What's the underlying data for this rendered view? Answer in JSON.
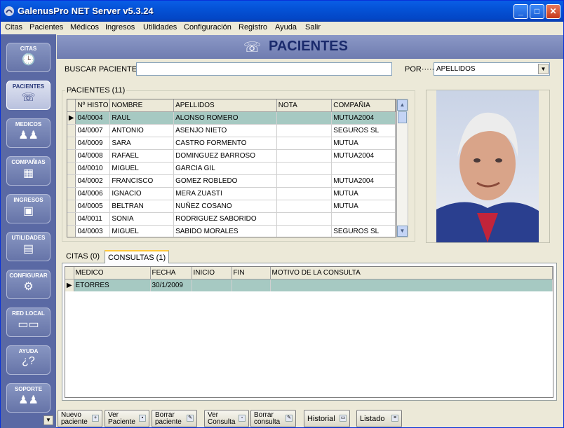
{
  "window": {
    "title": "GalenusPro NET Server v5.3.24"
  },
  "menu": [
    "Citas",
    "Pacientes",
    "Médicos",
    "Ingresos",
    "Utilidades",
    "Configuración",
    "Registro",
    "Ayuda",
    "Salir"
  ],
  "sidebar": [
    {
      "label": "CITAS",
      "icon": "clock-icon"
    },
    {
      "label": "PACIENTES",
      "icon": "patient-icon"
    },
    {
      "label": "MEDICOS",
      "icon": "doctors-icon"
    },
    {
      "label": "COMPAÑIAS",
      "icon": "building-icon"
    },
    {
      "label": "INGRESOS",
      "icon": "money-icon"
    },
    {
      "label": "UTILIDADES",
      "icon": "tools-icon"
    },
    {
      "label": "CONFIGURAR",
      "icon": "gears-icon"
    },
    {
      "label": "RED LOCAL",
      "icon": "network-icon"
    },
    {
      "label": "AYUDA",
      "icon": "help-icon"
    },
    {
      "label": "SOPORTE",
      "icon": "support-icon"
    }
  ],
  "header": {
    "title": "PACIENTES"
  },
  "search": {
    "label": "BUSCAR PACIENTE··",
    "value": "",
    "por_label": "POR·····",
    "por_value": "APELLIDOS"
  },
  "patients": {
    "group_title": "PACIENTES (11)",
    "columns": [
      "Nº HISTO",
      "NOMBRE",
      "APELLIDOS",
      "NOTA",
      "COMPAÑIA"
    ],
    "rows": [
      [
        "04/0004",
        "RAUL",
        "ALONSO ROMERO",
        "",
        "MUTUA2004"
      ],
      [
        "04/0007",
        "ANTONIO",
        "ASENJO NIETO",
        "",
        "SEGUROS SL"
      ],
      [
        "04/0009",
        "SARA",
        "CASTRO FORMENTO",
        "",
        "MUTUA"
      ],
      [
        "04/0008",
        "RAFAEL",
        "DOMINGUEZ BARROSO",
        "",
        "MUTUA2004"
      ],
      [
        "04/0010",
        "MIGUEL",
        "GARCIA GIL",
        "",
        ""
      ],
      [
        "04/0002",
        "FRANCISCO",
        "GOMEZ ROBLEDO",
        "",
        "MUTUA2004"
      ],
      [
        "04/0006",
        "IGNACIO",
        "MERA ZUASTI",
        "",
        "MUTUA"
      ],
      [
        "04/0005",
        "BELTRAN",
        "NUÑEZ COSANO",
        "",
        "MUTUA"
      ],
      [
        "04/0011",
        "SONIA",
        "RODRIGUEZ SABORIDO",
        "",
        ""
      ],
      [
        "04/0003",
        "MIGUEL",
        "SABIDO MORALES",
        "",
        "SEGUROS SL"
      ]
    ]
  },
  "tabs": {
    "citas": "CITAS (0)",
    "consultas": "CONSULTAS (1)"
  },
  "consultas": {
    "columns": [
      "MEDICO",
      "FECHA",
      "INICIO",
      "FIN",
      "MOTIVO DE LA CONSULTA"
    ],
    "rows": [
      [
        "ETORRES",
        "30/1/2009",
        "",
        "",
        ""
      ]
    ]
  },
  "buttons": {
    "nuevo": [
      "Nuevo",
      "paciente"
    ],
    "ver": [
      "Ver",
      "Paciente"
    ],
    "borrar": [
      "Borrar",
      "paciente"
    ],
    "ver_consulta": [
      "Ver",
      "Consulta"
    ],
    "borrar_consulta": [
      "Borrar",
      "consulta"
    ],
    "historial": "Historial",
    "listado": "Listado"
  },
  "colors": {
    "selected_row": "#a6c9c2",
    "sidebar": "#5a69a4",
    "header_title": "#1a2a6c"
  }
}
